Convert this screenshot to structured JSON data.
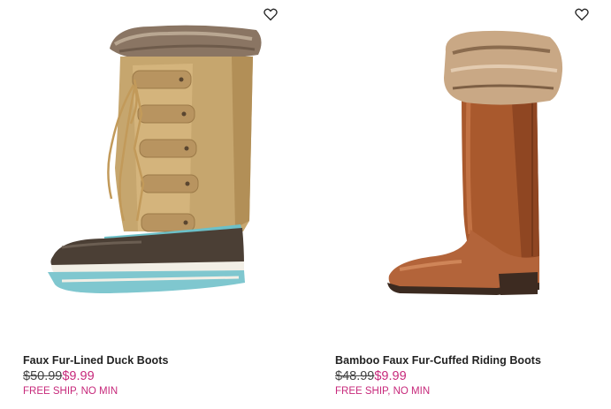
{
  "products": [
    {
      "name": "Faux Fur-Lined Duck Boots",
      "price_original": "$50.99",
      "price_sale": "$9.99",
      "promo": "FREE SHIP, NO MIN",
      "wishlist_icon": "heart-outline-icon"
    },
    {
      "name": "Bamboo Faux Fur-Cuffed Riding Boots",
      "price_original": "$48.99",
      "price_sale": "$9.99",
      "promo": "FREE SHIP, NO MIN",
      "wishlist_icon": "heart-outline-icon"
    }
  ],
  "colors": {
    "sale_price": "#c7297b",
    "promo": "#c7297b",
    "name_text": "#222222"
  }
}
